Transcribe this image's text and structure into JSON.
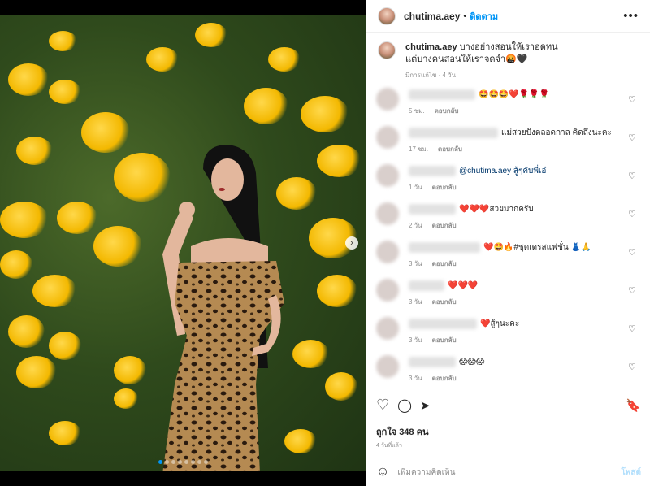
{
  "post": {
    "username": "chutima.aey",
    "separator": "•",
    "follow_label": "ติดตาม",
    "more_label": "•••",
    "caption_line1": "บางอย่างสอนให้เราอดทน",
    "caption_line2": "แต่บางคนสอนให้เราจดจำ🤬🖤",
    "caption_meta": "มีการแก้ไข · 4 วัน",
    "likes": "ถูกใจ 348 คน",
    "posted_ago": "4 วันที่แล้ว"
  },
  "comments": [
    {
      "text": "🤩🤩🤩❤️🌹🌹🌹",
      "time": "5 ชม.",
      "reply": "ตอบกลับ"
    },
    {
      "text": "แม่สวยปังตลอดกาล คิดถึงนะคะ",
      "time": "17 ชม.",
      "reply": "ตอบกลับ"
    },
    {
      "text": "@chutima.aey สู้ๆคับพี่เอ๋",
      "time": "1 วัน",
      "reply": "ตอบกลับ"
    },
    {
      "text": "❤️❤️❤️สวยมากครับ",
      "time": "2 วัน",
      "reply": "ตอบกลับ"
    },
    {
      "text": "❤️🤩🔥#ชุดเดรสแฟชั่น 👗🙏",
      "time": "3 วัน",
      "reply": "ตอบกลับ"
    },
    {
      "text": "❤️❤️❤️",
      "time": "3 วัน",
      "reply": "ตอบกลับ"
    },
    {
      "text": "❤️สู้ๆนะคะ",
      "time": "3 วัน",
      "reply": "ตอบกลับ"
    },
    {
      "text": "😱😱😱",
      "time": "3 วัน",
      "reply": "ตอบกลับ"
    }
  ],
  "composer": {
    "placeholder": "เพิ่มความคิดเห็น",
    "post_label": "โพสต์"
  },
  "icons": {
    "heart": "♡",
    "comment": "◯",
    "share": "➤",
    "save": "🔖",
    "emoji": "☺",
    "next": "›"
  },
  "colors": {
    "accent": "#0095f6",
    "post_disabled": "#b2dffc",
    "like_red": "#ed4956"
  }
}
